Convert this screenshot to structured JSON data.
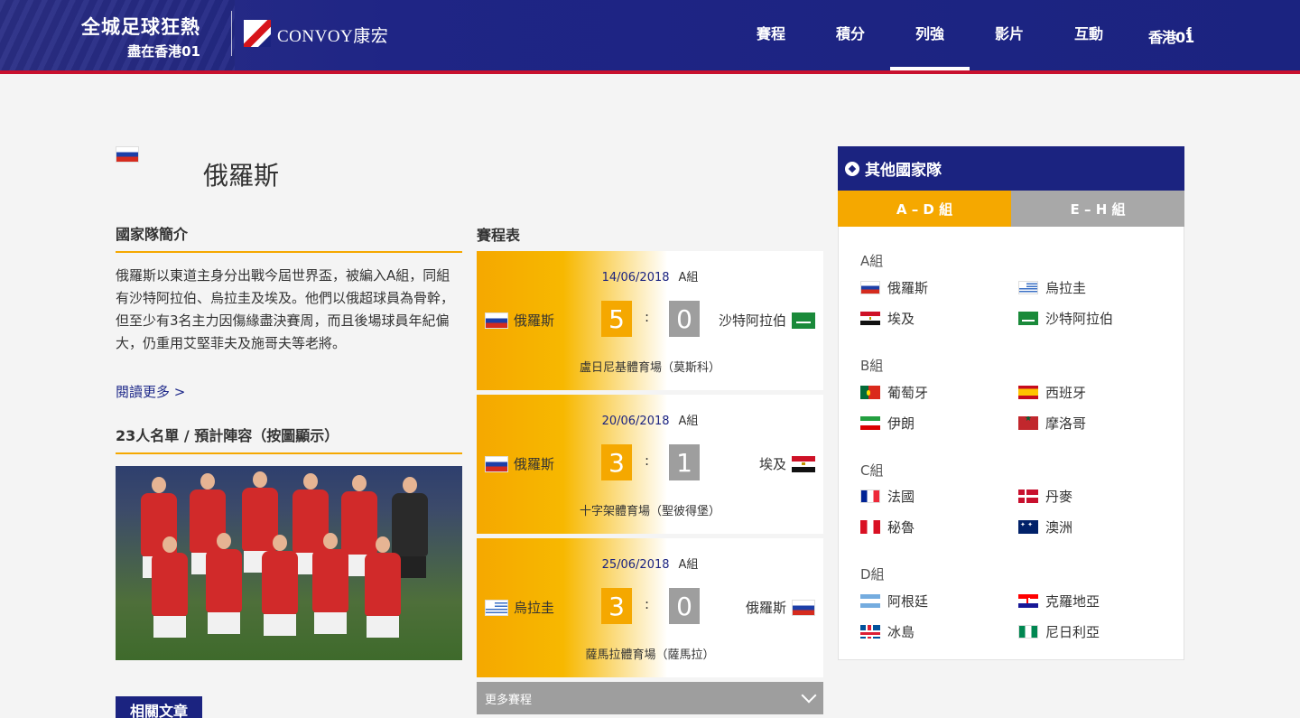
{
  "header": {
    "logo_line1": "全城足球狂熱",
    "logo_line2": "盡在香港01",
    "sponsor": "CONVOY康宏",
    "nav": [
      "賽程",
      "積分",
      "列強",
      "影片",
      "互動"
    ],
    "active_nav": "列強",
    "icons": [
      "hk01-icon",
      "facebook-icon"
    ]
  },
  "team": {
    "name": "俄羅斯",
    "flag": "russia-flag"
  },
  "intro": {
    "title": "國家隊簡介",
    "text": "俄羅斯以東道主身分出戰今屆世界盃，被編入A組，同組有沙特阿拉伯、烏拉圭及埃及。他們以俄超球員為骨幹，但至少有3名主力因傷緣盡決賽周，而且後場球員年紀偏大，仍重用艾堅菲夫及施哥夫等老將。",
    "read_more": "閱讀更多 >"
  },
  "squad": {
    "title": "23人名單 / 預計陣容（按圖顯示）"
  },
  "related": {
    "label": "相關文章"
  },
  "schedule": {
    "title": "賽程表",
    "matches": [
      {
        "date": "14/06/2018",
        "group": "A組",
        "home": "俄羅斯",
        "away": "沙特阿拉伯",
        "home_score": "5",
        "away_score": "0",
        "sep": ":",
        "venue": "盧日尼基體育場（莫斯科）"
      },
      {
        "date": "20/06/2018",
        "group": "A組",
        "home": "俄羅斯",
        "away": "埃及",
        "home_score": "3",
        "away_score": "1",
        "sep": ":",
        "venue": "十字架體育場（聖彼得堡）"
      },
      {
        "date": "25/06/2018",
        "group": "A組",
        "home": "烏拉圭",
        "away": "俄羅斯",
        "home_score": "3",
        "away_score": "0",
        "sep": ":",
        "venue": "薩馬拉體育場（薩馬拉）"
      }
    ],
    "more": "更多賽程"
  },
  "sidebar": {
    "title": "其他國家隊",
    "tabs": [
      "A – D 組",
      "E – H 組"
    ],
    "active_tab": "A – D 組",
    "groups": [
      {
        "label": "A組",
        "teams": [
          "俄羅斯",
          "烏拉圭",
          "埃及",
          "沙特阿拉伯"
        ]
      },
      {
        "label": "B組",
        "teams": [
          "葡萄牙",
          "西班牙",
          "伊朗",
          "摩洛哥"
        ]
      },
      {
        "label": "C組",
        "teams": [
          "法國",
          "丹麥",
          "秘魯",
          "澳洲"
        ]
      },
      {
        "label": "D組",
        "teams": [
          "阿根廷",
          "克羅地亞",
          "冰島",
          "尼日利亞"
        ]
      }
    ]
  },
  "colors": {
    "brand_blue": "#1b2380",
    "accent_orange": "#f5a800",
    "header_red": "#c8102e",
    "grey": "#9e9e9e"
  }
}
